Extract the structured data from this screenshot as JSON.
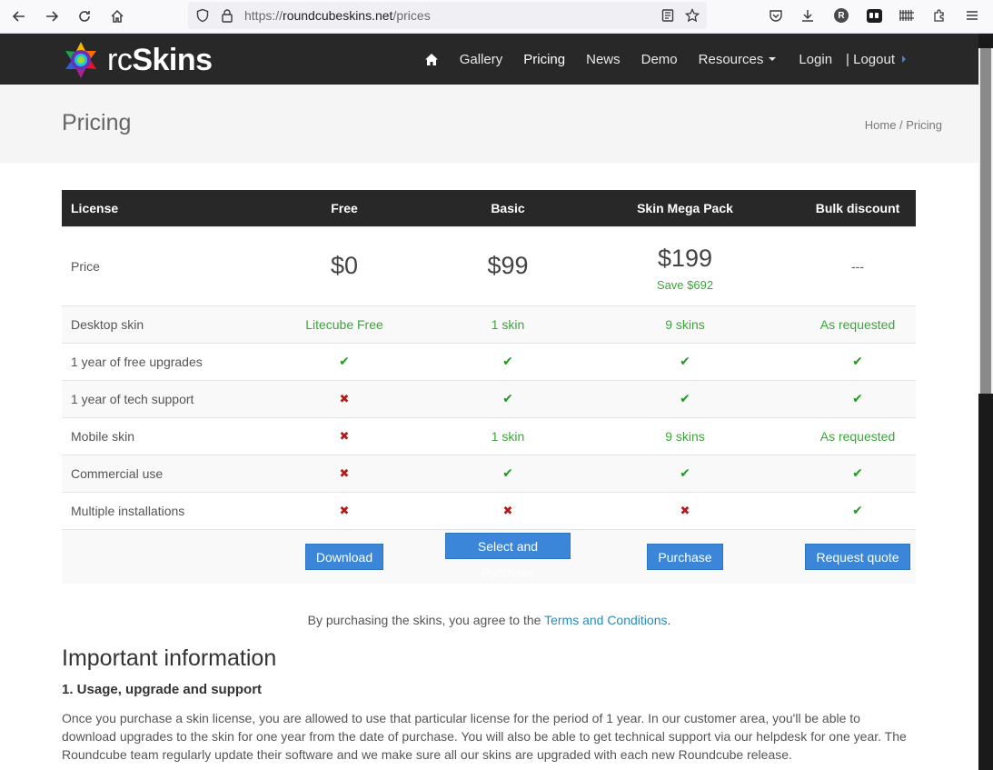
{
  "browser": {
    "url_scheme": "https://",
    "url_host": "roundcubeskins.net",
    "url_path": "/prices",
    "account_letter": "R"
  },
  "site": {
    "logo_rc": "rc",
    "logo_skins": "Skins",
    "nav": {
      "gallery": "Gallery",
      "pricing": "Pricing",
      "news": "News",
      "demo": "Demo",
      "resources": "Resources",
      "login": "Login",
      "logout": "| Logout"
    }
  },
  "title_bar": {
    "title": "Pricing",
    "breadcrumb": "Home / Pricing"
  },
  "table": {
    "headers": [
      "License",
      "Free",
      "Basic",
      "Skin Mega Pack",
      "Bulk discount"
    ],
    "price_label": "Price",
    "prices": [
      "$0",
      "$99",
      "$199",
      "---"
    ],
    "save_text": "Save $692",
    "rows": [
      {
        "label": "Desktop skin",
        "cells": [
          {
            "t": "text",
            "v": "Litecube Free"
          },
          {
            "t": "text",
            "v": "1 skin"
          },
          {
            "t": "text",
            "v": "9 skins"
          },
          {
            "t": "text",
            "v": "As requested"
          }
        ]
      },
      {
        "label": "1 year of free upgrades",
        "cells": [
          {
            "t": "check"
          },
          {
            "t": "check"
          },
          {
            "t": "check"
          },
          {
            "t": "check"
          }
        ]
      },
      {
        "label": "1 year of tech support",
        "cells": [
          {
            "t": "cross"
          },
          {
            "t": "check"
          },
          {
            "t": "check"
          },
          {
            "t": "check"
          }
        ]
      },
      {
        "label": "Mobile skin",
        "cells": [
          {
            "t": "cross"
          },
          {
            "t": "text",
            "v": "1 skin"
          },
          {
            "t": "text",
            "v": "9 skins"
          },
          {
            "t": "text",
            "v": "As requested"
          }
        ]
      },
      {
        "label": "Commercial use",
        "cells": [
          {
            "t": "cross"
          },
          {
            "t": "check"
          },
          {
            "t": "check"
          },
          {
            "t": "check"
          }
        ]
      },
      {
        "label": "Multiple installations",
        "cells": [
          {
            "t": "cross"
          },
          {
            "t": "cross"
          },
          {
            "t": "cross"
          },
          {
            "t": "check"
          }
        ]
      }
    ],
    "buttons": [
      "Download",
      "Select and Purchase",
      "Purchase",
      "Request quote"
    ],
    "check_glyph": "✔",
    "cross_glyph": "✖"
  },
  "terms": {
    "prefix": "By purchasing the skins, you agree to the ",
    "link": "Terms and Conditions",
    "suffix": "."
  },
  "info": {
    "heading": "Important information",
    "subheading": "1. Usage, upgrade and support",
    "paragraph": "Once you purchase a skin license, you are allowed to use that particular license for the period of 1 year. In our customer area, you'll be able to download upgrades to the skin for one year from the date of purchase. You will also be able to get technical support via our helpdesk for one year. The Roundcube team regularly update their software and we make sure all our skins are upgraded with each new Roundcube release."
  }
}
